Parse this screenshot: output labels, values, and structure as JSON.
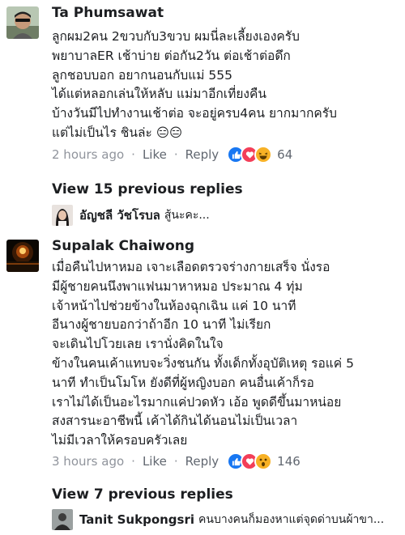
{
  "comments": [
    {
      "author": "Ta Phumsawat",
      "lines": [
        "ลูกผม2คน 2ขวบกับ3ขวบ ผมนี่ละเลี้ยงเองครับ",
        "พยาบาลER  เช้าบ่าย ต่อกัน2วัน ต่อเช้าต่อดึก",
        "ลูกชอบบอก อยากนอนกับแม่ 555",
        "ได้แต่หลอกเล่นให้หลับ  แม่มาอีกเที่ยงคืน",
        "บ้างวันมีไปทำงานเช้าต่อ  จะอยู่ครบ4คน ยากมากครับ",
        "แต่ไม่เป็นไร ชินล่ะ 😑😑"
      ],
      "time": "2 hours ago",
      "like": "Like",
      "reply": "Reply",
      "reaction_count": "64"
    },
    {
      "author": "Supalak Chaiwong",
      "lines": [
        "เมื่อคืนไปหาหมอ เจาะเลือดตรวจร่างกายเสร็จ นั่งรอ",
        "มีผู้ชายคนนึงพาแฟนมาหาหมอ ประมาณ 4 ทุ่ม",
        "เจ้าหน้าไปช่วยข้างในห้องฉุกเฉิน แค่ 10 นาที",
        "อีนางผู้ชายบอกว่าถ้าอีก 10 นาที ไม่เรียก",
        "จะเดินไปโวยเลย เรานั่งคิดในใจ",
        "ข้างในคนเค้าแทบจะวิ่งชนกัน ทั้งเด็กทั้งอุบัติเหตุ รอแค่ 5",
        "นาที ทำเป็นโมโห ยังดีที่ผู้หญิงบอก คนอื่นเค้าก็รอ",
        "เราไม่ได้เป็นอะไรมากแค่ปวดหัว เอ้อ พูดดีขึ้นมาหน่อย",
        "สงสารนะอาชีพนี้ เค้าได้กินได้นอนไม่เป็นเวลา",
        "ไม่มีเวลาให้ครอบครัวเลย"
      ],
      "time": "3 hours ago",
      "like": "Like",
      "reply": "Reply",
      "reaction_count": "146"
    }
  ],
  "separator": "·",
  "replies_blocks": [
    {
      "view_label": "View 15 previous replies",
      "reply_author": "อัญชลี วัชโรบล",
      "reply_text": "สู้นะคะ..."
    },
    {
      "view_label": "View 7 previous replies",
      "reply_author": "Tanit Sukpongsri",
      "reply_text": "คนบางคนก็มองหาแต่จุดด่าบนผ้าขา..."
    }
  ],
  "colors": {
    "like_blue": "#1877f2",
    "love_red": "#f33e58",
    "haha_yellow": "#f7b125",
    "meta_gray": "#90949c"
  },
  "icons": {
    "reactions_1": [
      "like-icon",
      "love-icon",
      "haha-icon"
    ],
    "reactions_2": [
      "like-icon",
      "love-icon",
      "wow-icon"
    ]
  }
}
